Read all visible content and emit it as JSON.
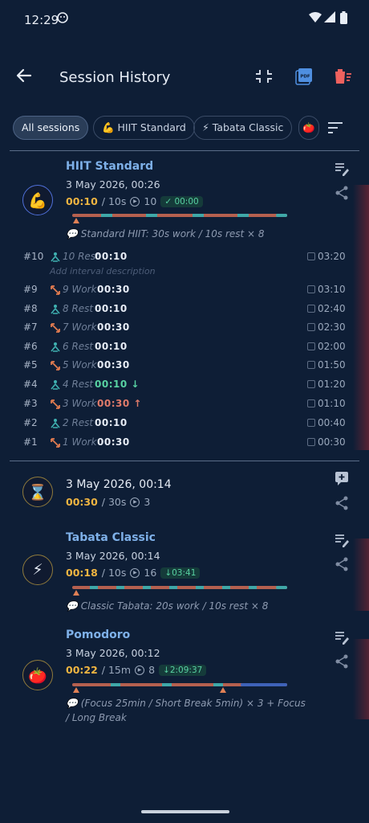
{
  "status": {
    "time": "12:29"
  },
  "appbar": {
    "title": "Session History"
  },
  "filters": {
    "chips": [
      {
        "label": "All sessions",
        "active": true
      },
      {
        "label": "💪 HIIT Standard",
        "active": false
      },
      {
        "label": "⚡ Tabata Classic",
        "active": false
      },
      {
        "label": "🍅",
        "active": false
      }
    ]
  },
  "sessions": [
    {
      "name": "HIIT Standard",
      "date": "3 May 2026, 00:26",
      "duration": "00:10",
      "planned": "/ 10s",
      "rounds": "10",
      "badge": "✓ 00:00",
      "description": "💬 Standard HIIT: 30s work / 10s rest × 8",
      "icon": "muscle-icon",
      "intervals": [
        {
          "num": "#10",
          "kind": "rest",
          "label": "10 Rest",
          "value": "00:10",
          "cum": "03:20",
          "note": "Add interval description"
        },
        {
          "num": "#9",
          "kind": "work",
          "label": "9 Work",
          "value": "00:30",
          "cum": "03:10"
        },
        {
          "num": "#8",
          "kind": "rest",
          "label": "8 Rest",
          "value": "00:10",
          "cum": "02:40"
        },
        {
          "num": "#7",
          "kind": "work",
          "label": "7 Work",
          "value": "00:30",
          "cum": "02:30"
        },
        {
          "num": "#6",
          "kind": "rest",
          "label": "6 Rest",
          "value": "00:10",
          "cum": "02:00"
        },
        {
          "num": "#5",
          "kind": "work",
          "label": "5 Work",
          "value": "00:30",
          "cum": "01:50"
        },
        {
          "num": "#4",
          "kind": "rest",
          "label": "4 Rest",
          "value": "00:10 ↓",
          "cum": "01:20",
          "color": "#58d2a2"
        },
        {
          "num": "#3",
          "kind": "work",
          "label": "3 Work",
          "value": "00:30 ↑",
          "cum": "01:10",
          "color": "#e07b6a"
        },
        {
          "num": "#2",
          "kind": "rest",
          "label": "2 Rest",
          "value": "00:10",
          "cum": "00:40"
        },
        {
          "num": "#1",
          "kind": "work",
          "label": "1 Work",
          "value": "00:30",
          "cum": "00:30"
        }
      ]
    },
    {
      "name": "",
      "date": "3 May 2026, 00:14",
      "duration": "00:30",
      "planned": "/ 30s",
      "rounds": "3",
      "icon": "hourglass-icon"
    },
    {
      "name": "Tabata Classic",
      "date": "3 May 2026, 00:14",
      "duration": "00:18",
      "planned": "/ 10s",
      "rounds": "16",
      "badge": "↓03:41",
      "description": "💬 Classic Tabata: 20s work / 10s rest × 8",
      "icon": "lightning-icon"
    },
    {
      "name": "Pomodoro",
      "date": "3 May 2026, 00:12",
      "duration": "00:22",
      "planned": "/ 15m",
      "rounds": "8",
      "badge": "↓2:09:37",
      "description": "💬 (Focus 25min / Short Break 5min) × 3 + Focus / Long Break",
      "icon": "tomato-icon"
    }
  ],
  "colors": {
    "accent_blue": "#7eb0e8",
    "duration": "#f0b541",
    "work": "#e07b50",
    "rest": "#58c5c0",
    "danger": "#f0615e"
  }
}
